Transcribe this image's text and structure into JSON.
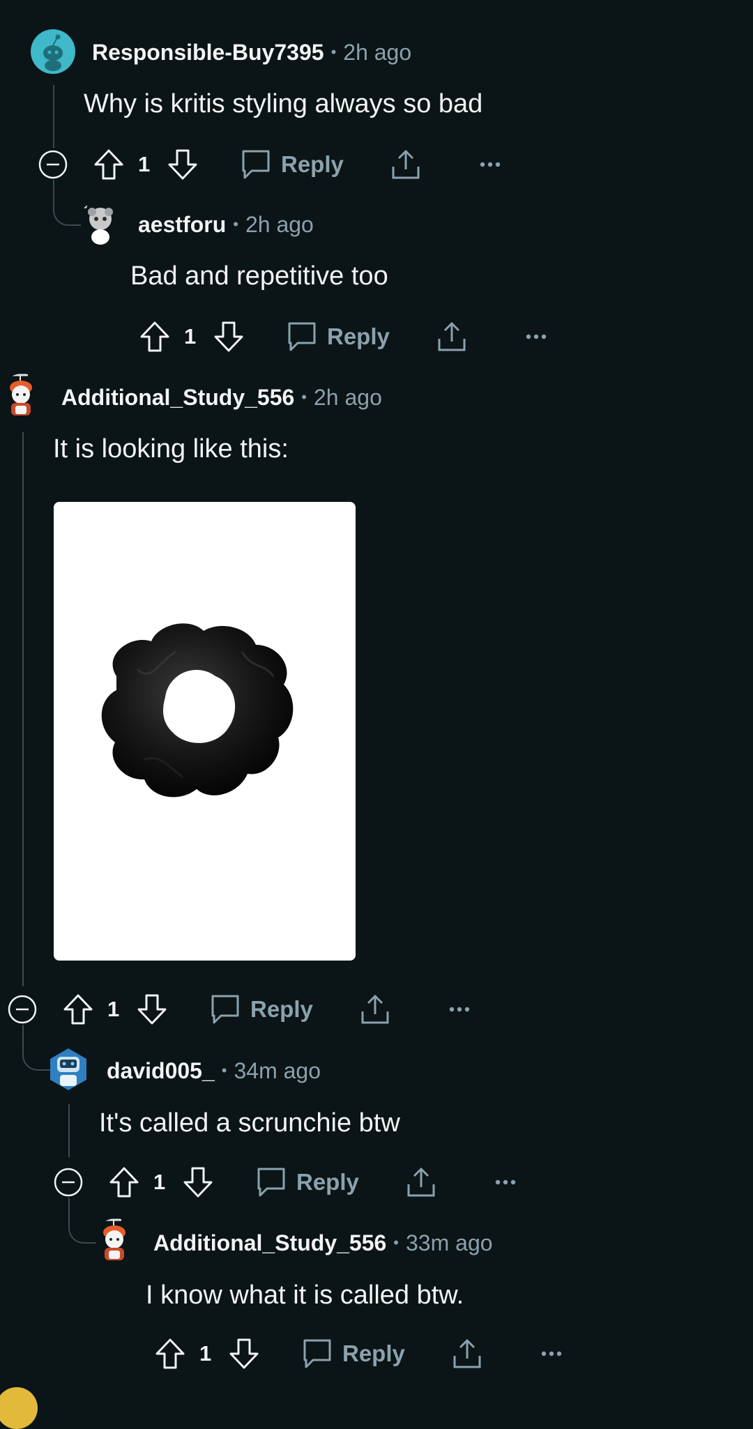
{
  "comments": [
    {
      "user": "Responsible-Buy7395",
      "time": "2h ago",
      "text": "Why is kritis styling always so bad",
      "score": "1",
      "reply_label": "Reply"
    },
    {
      "user": "aestforu",
      "time": "2h ago",
      "text": "Bad and repetitive too",
      "score": "1",
      "reply_label": "Reply"
    },
    {
      "user": "Additional_Study_556",
      "time": "2h ago",
      "text": "It is looking like this:",
      "score": "1",
      "reply_label": "Reply"
    },
    {
      "user": "david005_",
      "time": "34m ago",
      "text": "It's called a scrunchie btw",
      "score": "1",
      "reply_label": "Reply"
    },
    {
      "user": "Additional_Study_556",
      "time": "33m ago",
      "text": "I know what it is called btw.",
      "score": "1",
      "reply_label": "Reply"
    }
  ],
  "separator": "•",
  "colors": {
    "background": "#0b1416",
    "thread_line": "#3c4a4f",
    "muted": "#8ba2ad",
    "text": "#f2f4f5"
  },
  "icons": [
    "collapse-icon",
    "upvote-icon",
    "downvote-icon",
    "comment-icon",
    "share-icon",
    "more-icon"
  ]
}
